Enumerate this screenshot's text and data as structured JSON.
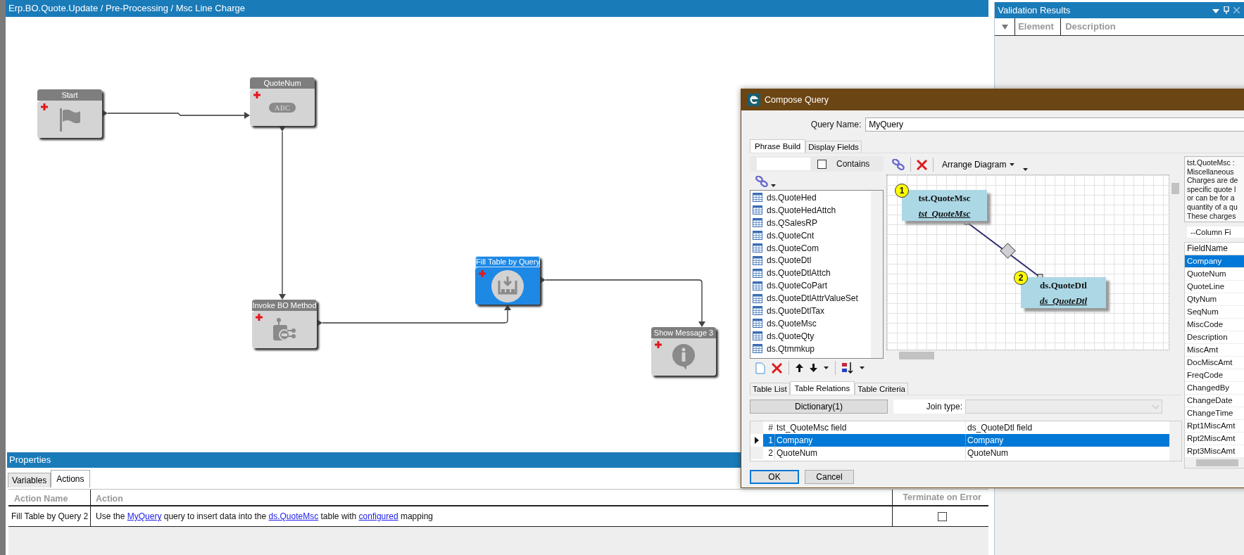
{
  "workflow": {
    "title": "Erp.BO.Quote.Update / Pre-Processing / Msc Line Charge",
    "nodes": [
      {
        "label": "Start",
        "kind": "start",
        "selected": false
      },
      {
        "label": "QuoteNum",
        "kind": "variable",
        "icon_text": "ABC",
        "selected": false
      },
      {
        "label": "Invoke BO Method",
        "kind": "invoke",
        "selected": false
      },
      {
        "label": "Fill Table by Query",
        "kind": "fill",
        "selected": true
      },
      {
        "label": "Show Message 3",
        "kind": "message",
        "selected": false
      }
    ]
  },
  "validation_results": {
    "title": "Validation Results",
    "columns": [
      "Element",
      "Description"
    ]
  },
  "properties": {
    "title": "Properties",
    "tabs": [
      {
        "label": "Variables",
        "selected": false
      },
      {
        "label": "Actions",
        "selected": true
      }
    ],
    "columns": [
      "Action Name",
      "Action",
      "Terminate on Error"
    ],
    "rows": [
      {
        "action_name": "Fill Table by Query 2",
        "action": [
          {
            "kind": "text",
            "text": "Use the "
          },
          {
            "kind": "link",
            "text": "MyQuery"
          },
          {
            "kind": "text",
            "text": " query to insert data into the "
          },
          {
            "kind": "link",
            "text": "ds.QuoteMsc"
          },
          {
            "kind": "text",
            "text": " table with "
          },
          {
            "kind": "link",
            "text": "configured"
          },
          {
            "kind": "text",
            "text": " mapping"
          }
        ],
        "terminate_on_error": false
      }
    ]
  },
  "compose_query": {
    "title": "Compose Query",
    "query_name_label": "Query Name:",
    "query_name": "MyQuery",
    "tabs": [
      {
        "label": "Phrase Build",
        "selected": true
      },
      {
        "label": "Display Fields",
        "selected": false
      }
    ],
    "contains_label": "Contains",
    "contains_checked": false,
    "tables": [
      {
        "name": "ds.QuoteHed"
      },
      {
        "name": "ds.QuoteHedAttch"
      },
      {
        "name": "ds.QSalesRP"
      },
      {
        "name": "ds.QuoteCnt"
      },
      {
        "name": "ds.QuoteCom"
      },
      {
        "name": "ds.QuoteDtl"
      },
      {
        "name": "ds.QuoteDtlAttch"
      },
      {
        "name": "ds.QuoteCoPart"
      },
      {
        "name": "ds.QuoteDtlAttrValueSet"
      },
      {
        "name": "ds.QuoteDtlTax"
      },
      {
        "name": "ds.QuoteMsc"
      },
      {
        "name": "ds.QuoteQty"
      },
      {
        "name": "ds.Qtmmkup"
      }
    ],
    "arrange_label": "Arrange Diagram",
    "diagram_tables": [
      {
        "number": "1",
        "name": "tst.QuoteMsc",
        "alias": "tst_QuoteMsc"
      },
      {
        "number": "2",
        "name": "ds.QuoteDtl",
        "alias": "ds_QuoteDtl"
      }
    ],
    "description": [
      "tst.QuoteMsc :",
      "Miscellaneous",
      "Charges are de",
      "specific quote l",
      "or can be for a",
      "quantity of a qu",
      "These charges"
    ],
    "column_filter": "--Column Fi",
    "fields_header": "FieldName",
    "fields": [
      {
        "name": "Company",
        "selected": true
      },
      {
        "name": "QuoteNum",
        "selected": false
      },
      {
        "name": "QuoteLine",
        "selected": false
      },
      {
        "name": "QtyNum",
        "selected": false
      },
      {
        "name": "SeqNum",
        "selected": false
      },
      {
        "name": "MiscCode",
        "selected": false
      },
      {
        "name": "Description",
        "selected": false
      },
      {
        "name": "MiscAmt",
        "selected": false
      },
      {
        "name": "DocMiscAmt",
        "selected": false
      },
      {
        "name": "FreqCode",
        "selected": false
      },
      {
        "name": "ChangedBy",
        "selected": false
      },
      {
        "name": "ChangeDate",
        "selected": false
      },
      {
        "name": "ChangeTime",
        "selected": false
      },
      {
        "name": "Rpt1MiscAmt",
        "selected": false
      },
      {
        "name": "Rpt2MiscAmt",
        "selected": false
      },
      {
        "name": "Rpt3MiscAmt",
        "selected": false
      }
    ],
    "bottom_tabs": [
      {
        "label": "Table List",
        "selected": false
      },
      {
        "label": "Table Relations",
        "selected": true
      },
      {
        "label": "Table Criteria",
        "selected": false
      }
    ],
    "dictionary_button": "Dictionary(1)",
    "join_type_label": "Join type:",
    "relation_columns": [
      "#",
      "tst_QuoteMsc field",
      "ds_QuoteDtl field"
    ],
    "relations": [
      {
        "number": "1",
        "left": "Company",
        "right": "Company",
        "selected": true
      },
      {
        "number": "2",
        "left": "QuoteNum",
        "right": "QuoteNum",
        "selected": false
      }
    ],
    "buttons": [
      "OK",
      "Cancel"
    ]
  }
}
